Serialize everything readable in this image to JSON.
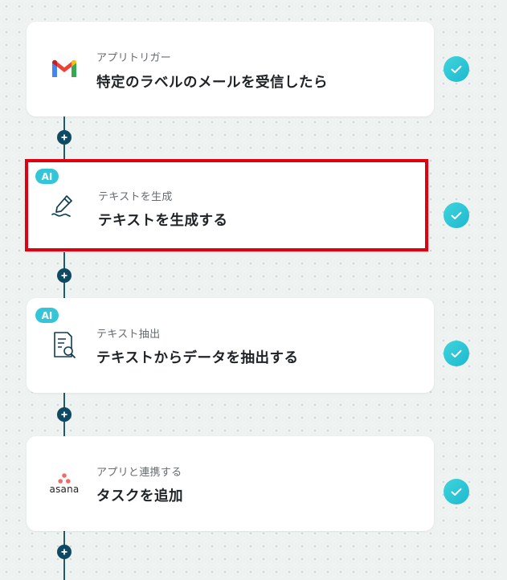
{
  "flow": {
    "steps": [
      {
        "category": "アプリトリガー",
        "title": "特定のラベルのメールを受信したら",
        "icon": "gmail-icon",
        "ai": false,
        "done": true
      },
      {
        "category": "テキストを生成",
        "title": "テキストを生成する",
        "icon": "pen-write-icon",
        "ai": true,
        "badge": "AI",
        "done": true
      },
      {
        "category": "テキスト抽出",
        "title": "テキストからデータを抽出する",
        "icon": "document-search-icon",
        "ai": true,
        "badge": "AI",
        "done": true
      },
      {
        "category": "アプリと連携する",
        "title": "タスクを追加",
        "icon": "asana-icon",
        "logo_text": "asana",
        "ai": false,
        "done": true
      }
    ]
  },
  "colors": {
    "accent": "#34c6d8",
    "check": "#1eb9cf",
    "line": "#1f5b6e",
    "plus": "#0f4a63",
    "highlight": "#e1000f"
  }
}
